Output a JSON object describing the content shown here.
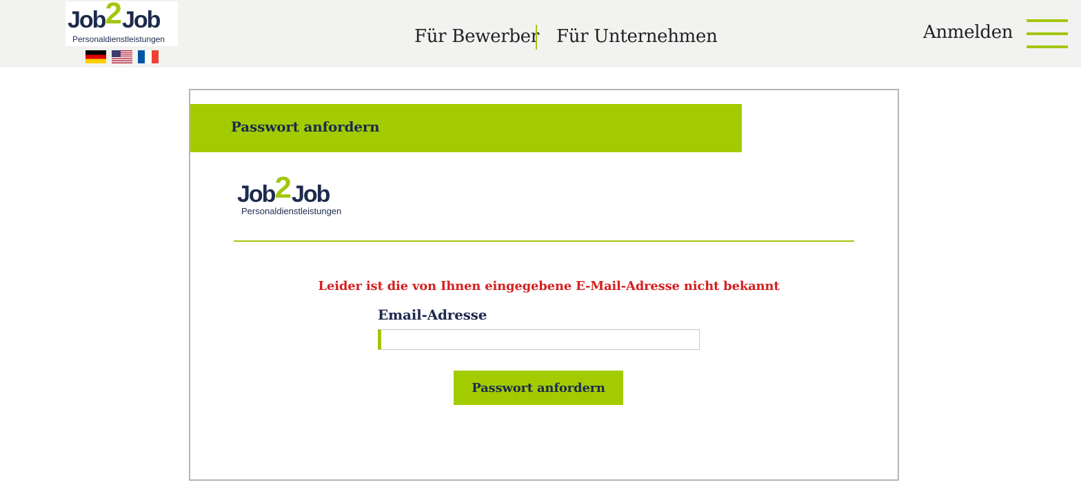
{
  "brand": {
    "logo_text_left": "Job",
    "logo_text_mid": "2",
    "logo_text_right": "Job",
    "logo_subtitle": "Personaldienstleistungen"
  },
  "languages": [
    {
      "code": "de",
      "icon": "german-flag-icon"
    },
    {
      "code": "en",
      "icon": "us-flag-icon"
    },
    {
      "code": "fr",
      "icon": "french-flag-icon"
    }
  ],
  "nav": {
    "applicants": "Für Bewerber",
    "companies": "Für Unternehmen",
    "login": "Anmelden",
    "menu_icon": "hamburger-menu-icon"
  },
  "form": {
    "title": "Passwort anfordern",
    "error_message": "Leider ist die von Ihnen eingegebene E-Mail-Adresse nicht bekannt",
    "email_label": "Email-Adresse",
    "email_value": "",
    "email_placeholder": "",
    "submit_label": "Passwort anfordern"
  },
  "colors": {
    "accent": "#a3c60f",
    "brand_navy": "#1d2a4d",
    "error": "#d42020",
    "header_bg": "#f2f3f1"
  }
}
